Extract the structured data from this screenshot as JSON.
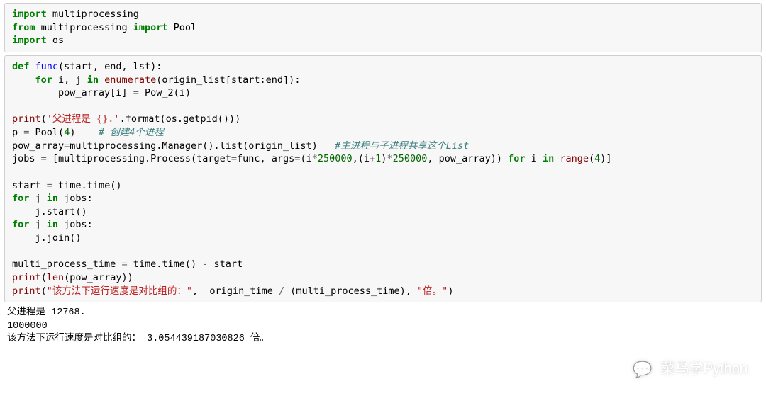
{
  "cell1": {
    "l1": {
      "kw": "import",
      "mod": "multiprocessing"
    },
    "l2": {
      "kw1": "from",
      "mod": "multiprocessing",
      "kw2": "import",
      "name": "Pool"
    },
    "l3": {
      "kw": "import",
      "mod": "os"
    }
  },
  "cell2": {
    "l1_def": "def",
    "l1_name": "func",
    "l1_params": "(start, end, lst):",
    "l2_for": "for",
    "l2_text": " i, j ",
    "l2_in": "in",
    "l2_enum": "enumerate",
    "l2_slice": "(origin_list[start:end]):",
    "l3_text": "        pow_array[i] ",
    "l3_eq": "=",
    "l3_rhs": " Pow_2(i)",
    "l5_print": "print",
    "l5_str": "'父进程是 {}.'",
    "l5_format": ".format(os.getpid()))",
    "l6_lhs": "p ",
    "l6_eq": "=",
    "l6_rhs": " Pool(",
    "l6_num": "4",
    "l6_close": ")    ",
    "l6_comment": "# 创建4个进程",
    "l7_lhs": "pow_array",
    "l7_eq": "=",
    "l7_rhs": "multiprocessing.Manager().list(origin_list)   ",
    "l7_comment": "#主进程与子进程共享这个List",
    "l8_lhs": "jobs ",
    "l8_eq": "=",
    "l8_open": " [multiprocessing.Process(target",
    "l8_eq2": "=",
    "l8_mid": "func, args",
    "l8_eq3": "=",
    "l8_args_open": "(i",
    "l8_star1": "*",
    "l8_num1": "250000",
    "l8_comma": ",(i",
    "l8_plus": "+",
    "l8_one": "1",
    "l8_close1": ")",
    "l8_star2": "*",
    "l8_num2": "250000",
    "l8_rest": ", pow_array)) ",
    "l8_for": "for",
    "l8_i": " i ",
    "l8_in": "in",
    "l8_range": "range",
    "l8_end": "(",
    "l8_four": "4",
    "l8_end2": ")]",
    "l10_lhs": "start ",
    "l10_eq": "=",
    "l10_rhs": " time.time()",
    "l11_for": "for",
    "l11_j": " j ",
    "l11_in": "in",
    "l11_rest": " jobs:",
    "l12": "    j.start()",
    "l13_for": "for",
    "l13_j": " j ",
    "l13_in": "in",
    "l13_rest": " jobs:",
    "l14": "    j.join()",
    "l16_lhs": "multi_process_time ",
    "l16_eq": "=",
    "l16_rhs": " time.time() ",
    "l16_minus": "-",
    "l16_start": " start",
    "l17_print": "print",
    "l17_open": "(",
    "l17_len": "len",
    "l17_arg": "(pow_array))",
    "l18_print": "print",
    "l18_open": "(",
    "l18_str1": "\"该方法下运行速度是对比组的：\"",
    "l18_mid": ",  origin_time ",
    "l18_div": "/",
    "l18_tail": " (multi_process_time), ",
    "l18_str2": "\"倍。\"",
    "l18_close": ")"
  },
  "output": {
    "l1": "父进程是 12768.",
    "l2": "1000000",
    "l3": "该方法下运行速度是对比组的： 3.054439187030826 倍。"
  },
  "watermark": {
    "text": "菜鸟学Python",
    "icon": "💬"
  }
}
